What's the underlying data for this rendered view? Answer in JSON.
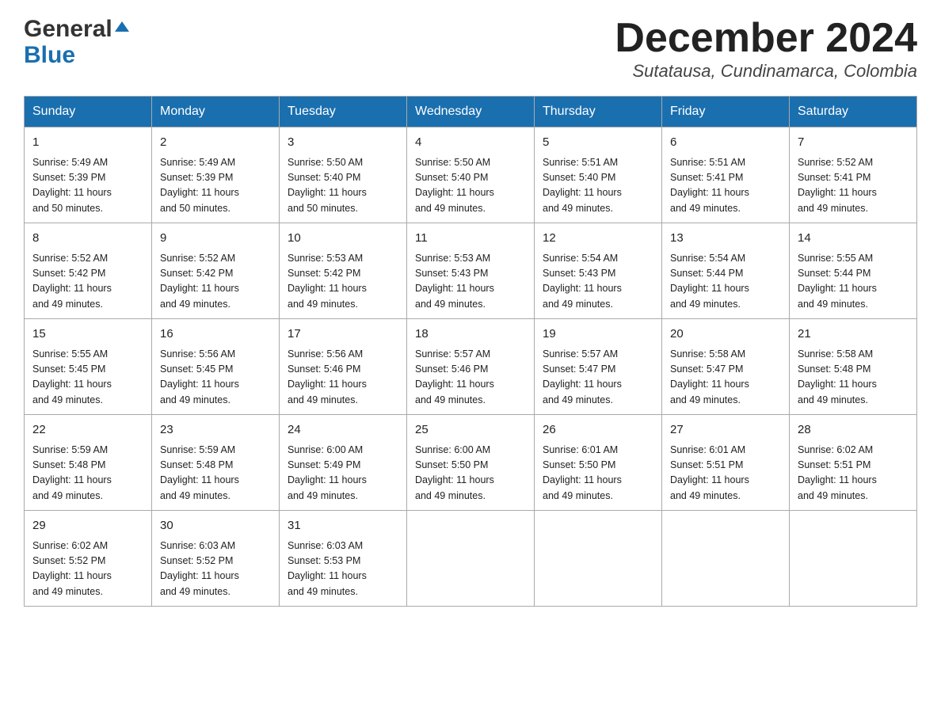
{
  "header": {
    "logo_general": "General",
    "logo_blue": "Blue",
    "month_title": "December 2024",
    "location": "Sutatausa, Cundinamarca, Colombia"
  },
  "weekdays": [
    "Sunday",
    "Monday",
    "Tuesday",
    "Wednesday",
    "Thursday",
    "Friday",
    "Saturday"
  ],
  "weeks": [
    [
      {
        "day": "1",
        "sunrise": "Sunrise: 5:49 AM",
        "sunset": "Sunset: 5:39 PM",
        "daylight": "Daylight: 11 hours",
        "daylight2": "and 50 minutes."
      },
      {
        "day": "2",
        "sunrise": "Sunrise: 5:49 AM",
        "sunset": "Sunset: 5:39 PM",
        "daylight": "Daylight: 11 hours",
        "daylight2": "and 50 minutes."
      },
      {
        "day": "3",
        "sunrise": "Sunrise: 5:50 AM",
        "sunset": "Sunset: 5:40 PM",
        "daylight": "Daylight: 11 hours",
        "daylight2": "and 50 minutes."
      },
      {
        "day": "4",
        "sunrise": "Sunrise: 5:50 AM",
        "sunset": "Sunset: 5:40 PM",
        "daylight": "Daylight: 11 hours",
        "daylight2": "and 49 minutes."
      },
      {
        "day": "5",
        "sunrise": "Sunrise: 5:51 AM",
        "sunset": "Sunset: 5:40 PM",
        "daylight": "Daylight: 11 hours",
        "daylight2": "and 49 minutes."
      },
      {
        "day": "6",
        "sunrise": "Sunrise: 5:51 AM",
        "sunset": "Sunset: 5:41 PM",
        "daylight": "Daylight: 11 hours",
        "daylight2": "and 49 minutes."
      },
      {
        "day": "7",
        "sunrise": "Sunrise: 5:52 AM",
        "sunset": "Sunset: 5:41 PM",
        "daylight": "Daylight: 11 hours",
        "daylight2": "and 49 minutes."
      }
    ],
    [
      {
        "day": "8",
        "sunrise": "Sunrise: 5:52 AM",
        "sunset": "Sunset: 5:42 PM",
        "daylight": "Daylight: 11 hours",
        "daylight2": "and 49 minutes."
      },
      {
        "day": "9",
        "sunrise": "Sunrise: 5:52 AM",
        "sunset": "Sunset: 5:42 PM",
        "daylight": "Daylight: 11 hours",
        "daylight2": "and 49 minutes."
      },
      {
        "day": "10",
        "sunrise": "Sunrise: 5:53 AM",
        "sunset": "Sunset: 5:42 PM",
        "daylight": "Daylight: 11 hours",
        "daylight2": "and 49 minutes."
      },
      {
        "day": "11",
        "sunrise": "Sunrise: 5:53 AM",
        "sunset": "Sunset: 5:43 PM",
        "daylight": "Daylight: 11 hours",
        "daylight2": "and 49 minutes."
      },
      {
        "day": "12",
        "sunrise": "Sunrise: 5:54 AM",
        "sunset": "Sunset: 5:43 PM",
        "daylight": "Daylight: 11 hours",
        "daylight2": "and 49 minutes."
      },
      {
        "day": "13",
        "sunrise": "Sunrise: 5:54 AM",
        "sunset": "Sunset: 5:44 PM",
        "daylight": "Daylight: 11 hours",
        "daylight2": "and 49 minutes."
      },
      {
        "day": "14",
        "sunrise": "Sunrise: 5:55 AM",
        "sunset": "Sunset: 5:44 PM",
        "daylight": "Daylight: 11 hours",
        "daylight2": "and 49 minutes."
      }
    ],
    [
      {
        "day": "15",
        "sunrise": "Sunrise: 5:55 AM",
        "sunset": "Sunset: 5:45 PM",
        "daylight": "Daylight: 11 hours",
        "daylight2": "and 49 minutes."
      },
      {
        "day": "16",
        "sunrise": "Sunrise: 5:56 AM",
        "sunset": "Sunset: 5:45 PM",
        "daylight": "Daylight: 11 hours",
        "daylight2": "and 49 minutes."
      },
      {
        "day": "17",
        "sunrise": "Sunrise: 5:56 AM",
        "sunset": "Sunset: 5:46 PM",
        "daylight": "Daylight: 11 hours",
        "daylight2": "and 49 minutes."
      },
      {
        "day": "18",
        "sunrise": "Sunrise: 5:57 AM",
        "sunset": "Sunset: 5:46 PM",
        "daylight": "Daylight: 11 hours",
        "daylight2": "and 49 minutes."
      },
      {
        "day": "19",
        "sunrise": "Sunrise: 5:57 AM",
        "sunset": "Sunset: 5:47 PM",
        "daylight": "Daylight: 11 hours",
        "daylight2": "and 49 minutes."
      },
      {
        "day": "20",
        "sunrise": "Sunrise: 5:58 AM",
        "sunset": "Sunset: 5:47 PM",
        "daylight": "Daylight: 11 hours",
        "daylight2": "and 49 minutes."
      },
      {
        "day": "21",
        "sunrise": "Sunrise: 5:58 AM",
        "sunset": "Sunset: 5:48 PM",
        "daylight": "Daylight: 11 hours",
        "daylight2": "and 49 minutes."
      }
    ],
    [
      {
        "day": "22",
        "sunrise": "Sunrise: 5:59 AM",
        "sunset": "Sunset: 5:48 PM",
        "daylight": "Daylight: 11 hours",
        "daylight2": "and 49 minutes."
      },
      {
        "day": "23",
        "sunrise": "Sunrise: 5:59 AM",
        "sunset": "Sunset: 5:48 PM",
        "daylight": "Daylight: 11 hours",
        "daylight2": "and 49 minutes."
      },
      {
        "day": "24",
        "sunrise": "Sunrise: 6:00 AM",
        "sunset": "Sunset: 5:49 PM",
        "daylight": "Daylight: 11 hours",
        "daylight2": "and 49 minutes."
      },
      {
        "day": "25",
        "sunrise": "Sunrise: 6:00 AM",
        "sunset": "Sunset: 5:50 PM",
        "daylight": "Daylight: 11 hours",
        "daylight2": "and 49 minutes."
      },
      {
        "day": "26",
        "sunrise": "Sunrise: 6:01 AM",
        "sunset": "Sunset: 5:50 PM",
        "daylight": "Daylight: 11 hours",
        "daylight2": "and 49 minutes."
      },
      {
        "day": "27",
        "sunrise": "Sunrise: 6:01 AM",
        "sunset": "Sunset: 5:51 PM",
        "daylight": "Daylight: 11 hours",
        "daylight2": "and 49 minutes."
      },
      {
        "day": "28",
        "sunrise": "Sunrise: 6:02 AM",
        "sunset": "Sunset: 5:51 PM",
        "daylight": "Daylight: 11 hours",
        "daylight2": "and 49 minutes."
      }
    ],
    [
      {
        "day": "29",
        "sunrise": "Sunrise: 6:02 AM",
        "sunset": "Sunset: 5:52 PM",
        "daylight": "Daylight: 11 hours",
        "daylight2": "and 49 minutes."
      },
      {
        "day": "30",
        "sunrise": "Sunrise: 6:03 AM",
        "sunset": "Sunset: 5:52 PM",
        "daylight": "Daylight: 11 hours",
        "daylight2": "and 49 minutes."
      },
      {
        "day": "31",
        "sunrise": "Sunrise: 6:03 AM",
        "sunset": "Sunset: 5:53 PM",
        "daylight": "Daylight: 11 hours",
        "daylight2": "and 49 minutes."
      },
      null,
      null,
      null,
      null
    ]
  ]
}
